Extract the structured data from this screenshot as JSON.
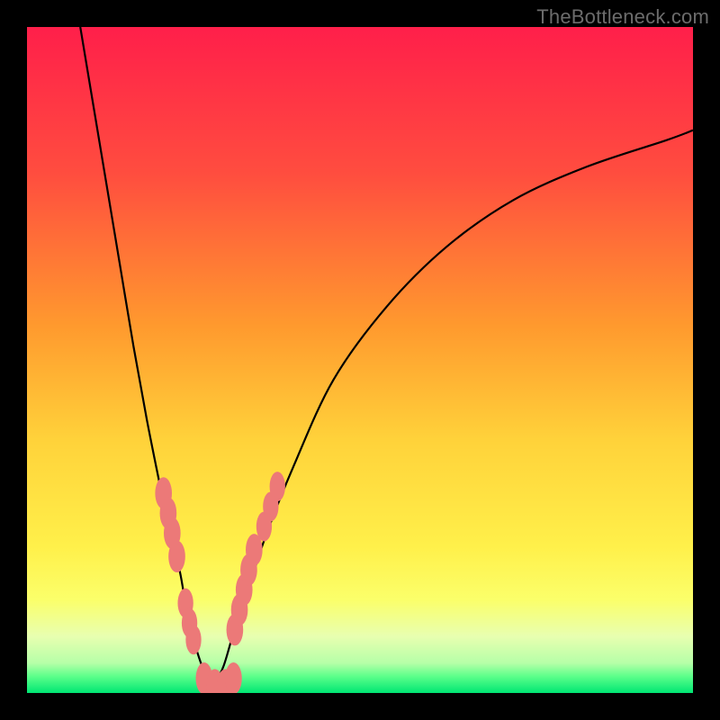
{
  "watermark": "TheBottleneck.com",
  "colors": {
    "frame_bg": "#000000",
    "marker": "#ec7978",
    "curve": "#000000",
    "gradient_stops": [
      {
        "pos": 0.0,
        "color": "#ff1f4a"
      },
      {
        "pos": 0.22,
        "color": "#ff4d3f"
      },
      {
        "pos": 0.45,
        "color": "#ff9a2e"
      },
      {
        "pos": 0.62,
        "color": "#ffd23a"
      },
      {
        "pos": 0.78,
        "color": "#fff04a"
      },
      {
        "pos": 0.86,
        "color": "#fbff6a"
      },
      {
        "pos": 0.915,
        "color": "#e8ffb0"
      },
      {
        "pos": 0.955,
        "color": "#b6ffa8"
      },
      {
        "pos": 0.975,
        "color": "#5cff8a"
      },
      {
        "pos": 1.0,
        "color": "#00e673"
      }
    ]
  },
  "chart_data": {
    "type": "line",
    "title": "",
    "xlabel": "",
    "ylabel": "",
    "xlim": [
      0,
      100
    ],
    "ylim": [
      0,
      100
    ],
    "note": "Two curves implying a V-shaped bottleneck profile. Y is bottleneck severity (low=green at bottom, high=red at top). X is an unlabeled parameter. Values estimated from pixel positions; axes not numerically labeled in source image, so x/y are normalized 0–100.",
    "series": [
      {
        "name": "left-curve",
        "x": [
          8,
          10,
          12,
          14,
          16,
          18,
          20,
          21,
          22,
          23,
          23.7,
          24.3,
          25,
          26.5,
          28
        ],
        "y": [
          100,
          88,
          76,
          64,
          52,
          41,
          31,
          26,
          22,
          18,
          14,
          11,
          8,
          3.5,
          1
        ]
      },
      {
        "name": "right-curve",
        "x": [
          28,
          29.5,
          31,
          33,
          36,
          40,
          46,
          54,
          63,
          73,
          84,
          96,
          100
        ],
        "y": [
          1,
          4,
          9,
          15,
          24,
          34,
          47,
          58,
          67,
          74,
          79,
          83,
          84.5
        ]
      }
    ],
    "markers": {
      "name": "highlighted-points",
      "color": "#ec7978",
      "points": [
        {
          "x": 20.5,
          "y": 30,
          "r": 1.4
        },
        {
          "x": 21.2,
          "y": 27,
          "r": 1.4
        },
        {
          "x": 21.8,
          "y": 24,
          "r": 1.4
        },
        {
          "x": 22.5,
          "y": 20.5,
          "r": 1.4
        },
        {
          "x": 23.8,
          "y": 13.5,
          "r": 1.3
        },
        {
          "x": 24.4,
          "y": 10.5,
          "r": 1.3
        },
        {
          "x": 25.0,
          "y": 8.0,
          "r": 1.3
        },
        {
          "x": 26.6,
          "y": 2.2,
          "r": 1.4
        },
        {
          "x": 28.2,
          "y": 1.2,
          "r": 1.4
        },
        {
          "x": 29.8,
          "y": 1.2,
          "r": 1.4
        },
        {
          "x": 31.0,
          "y": 2.2,
          "r": 1.4
        },
        {
          "x": 31.2,
          "y": 9.5,
          "r": 1.4
        },
        {
          "x": 31.9,
          "y": 12.5,
          "r": 1.4
        },
        {
          "x": 32.6,
          "y": 15.5,
          "r": 1.4
        },
        {
          "x": 33.3,
          "y": 18.5,
          "r": 1.4
        },
        {
          "x": 34.1,
          "y": 21.5,
          "r": 1.4
        },
        {
          "x": 35.6,
          "y": 25.0,
          "r": 1.3
        },
        {
          "x": 36.6,
          "y": 28.0,
          "r": 1.3
        },
        {
          "x": 37.6,
          "y": 31.0,
          "r": 1.3
        }
      ]
    }
  }
}
